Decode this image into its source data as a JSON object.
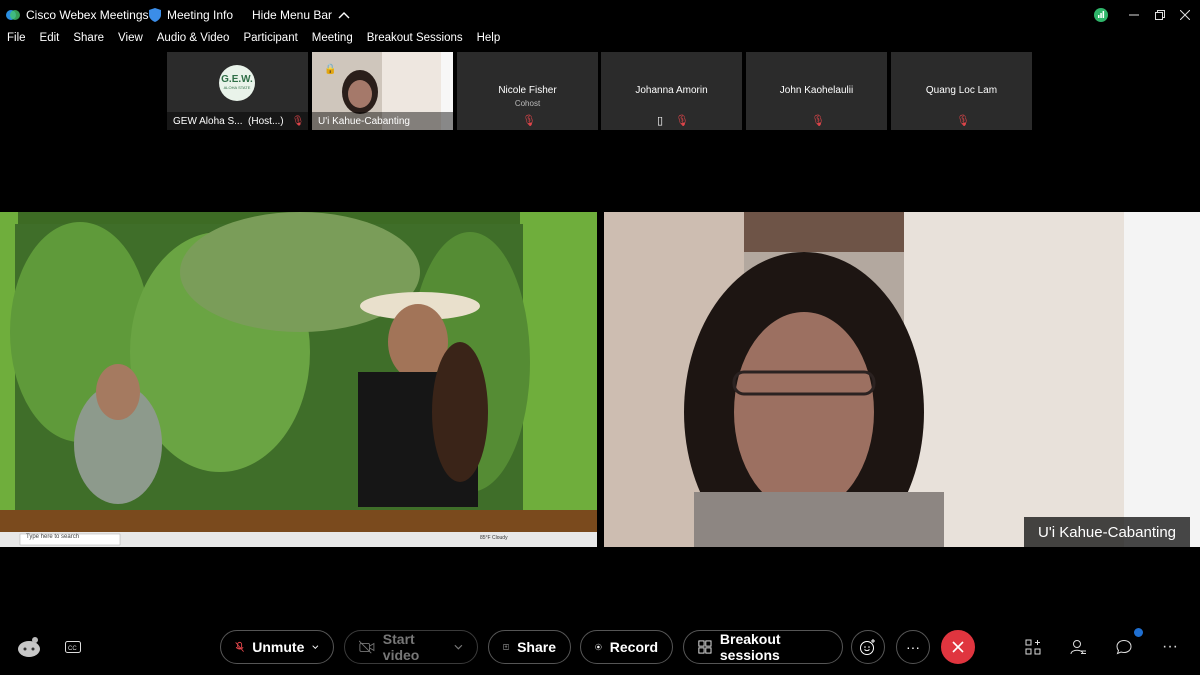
{
  "titlebar": {
    "app_name": "Cisco Webex Meetings",
    "meeting_info": "Meeting Info",
    "hide_menu_bar": "Hide Menu Bar"
  },
  "menu": [
    "File",
    "Edit",
    "Share",
    "View",
    "Audio & Video",
    "Participant",
    "Meeting",
    "Breakout Sessions",
    "Help"
  ],
  "participants": [
    {
      "label": "GEW Aloha S...",
      "suffix": "(Host...)",
      "logo_text": "G.E.W.",
      "logo_sub": "ALOHA STATE"
    },
    {
      "label": "U'i Kahue-Cabanting"
    },
    {
      "name": "Nicole Fisher",
      "role": "Cohost"
    },
    {
      "name": "Johanna Amorin"
    },
    {
      "name": "John Kaohelaulii"
    },
    {
      "name": "Quang Loc Lam"
    }
  ],
  "active_speaker": "U'i Kahue-Cabanting",
  "taskbar": {
    "search_placeholder": "Type here to search",
    "weather": "85°F Cloudy"
  },
  "controls": {
    "unmute": "Unmute",
    "start_video": "Start video",
    "share": "Share",
    "record": "Record",
    "breakout": "Breakout sessions"
  },
  "colors": {
    "end_call": "#e0353f",
    "accent": "#1f6fd1",
    "mic_muted": "#e0454a"
  }
}
